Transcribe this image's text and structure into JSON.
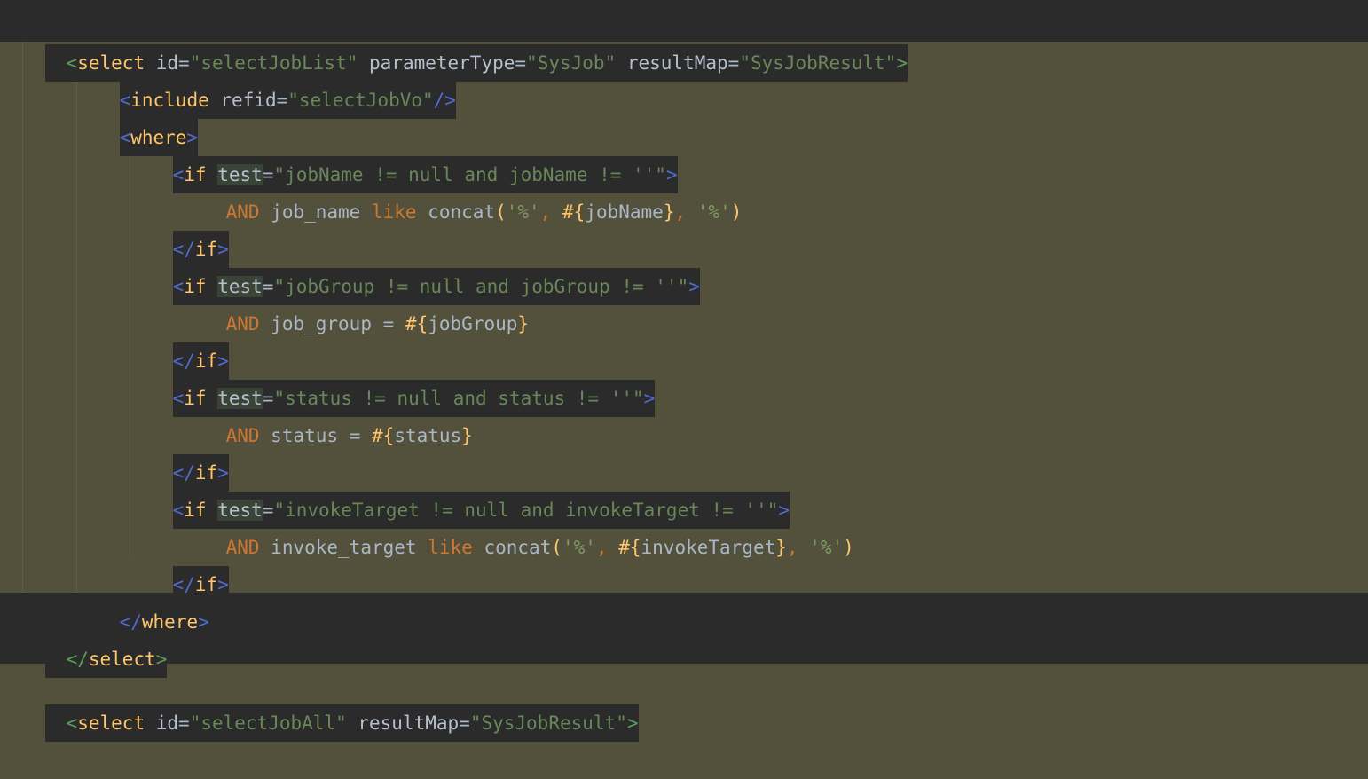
{
  "editor": {
    "language": "xml-mybatis",
    "theme": "darcula-olive-selection",
    "colors": {
      "selection_background": "#53503c",
      "editor_background": "#2b2b2b",
      "search_highlight": "#394437",
      "tag_name": "#ffc66d",
      "bracket_outer": "#5a9e5a",
      "bracket_inner": "#4f6ad0",
      "attribute_name": "#b7c0cc",
      "attribute_value": "#6a8759",
      "sql_keyword": "#cc7832",
      "identifier": "#a9b7c6",
      "punctuation": "#ffc66d",
      "string_literal": "#7f9a64",
      "indent_guide": "#5f5c48"
    },
    "search_term": "test"
  },
  "lines": [
    {
      "index": 0,
      "indent": "",
      "text": "<select id=\"selectJobList\" parameterType=\"SysJob\" resultMap=\"SysJobResult\">",
      "tokens": {
        "open": "<",
        "tag": "select",
        "a1_name": "id",
        "a1_eq": "=",
        "a1_val": "\"selectJobList\"",
        "a2_name": "parameterType",
        "a2_eq": "=",
        "a2_val": "\"SysJob\"",
        "a3_name": "resultMap",
        "a3_eq": "=",
        "a3_val": "\"SysJobResult\"",
        "close": ">"
      }
    },
    {
      "index": 1,
      "indent": "    ",
      "text": "<include refid=\"selectJobVo\"/>",
      "tokens": {
        "open": "<",
        "tag": "include",
        "a1_name": "refid",
        "a1_eq": "=",
        "a1_val": "\"selectJobVo\"",
        "close": "/>"
      }
    },
    {
      "index": 2,
      "indent": "    ",
      "text": "<where>",
      "tokens": {
        "open": "<",
        "tag": "where",
        "close": ">"
      }
    },
    {
      "index": 3,
      "indent": "        ",
      "text": "<if test=\"jobName != null and jobName != ''\">",
      "tokens": {
        "open": "<",
        "tag": "if",
        "a1_name": "test",
        "a1_eq": "=",
        "a1_val": "\"jobName != null and jobName != ''\"",
        "close": ">"
      }
    },
    {
      "index": 4,
      "indent": "            ",
      "text": "AND job_name like concat('%', #{jobName}, '%')",
      "tokens": {
        "kw1": "AND",
        "col": "job_name",
        "kw2": "like",
        "fn": "concat",
        "lparen": "(",
        "s1": "'%'",
        "c1": ",",
        "hash": "#",
        "lbrace": "{",
        "param": "jobName",
        "rbrace": "}",
        "c2": ",",
        "s2": "'%'",
        "rparen": ")"
      }
    },
    {
      "index": 5,
      "indent": "        ",
      "text": "</if>",
      "tokens": {
        "open": "</",
        "tag": "if",
        "close": ">"
      }
    },
    {
      "index": 6,
      "indent": "        ",
      "text": "<if test=\"jobGroup != null and jobGroup != ''\">",
      "tokens": {
        "open": "<",
        "tag": "if",
        "a1_name": "test",
        "a1_eq": "=",
        "a1_val": "\"jobGroup != null and jobGroup != ''\"",
        "close": ">"
      }
    },
    {
      "index": 7,
      "indent": "            ",
      "text": "AND job_group = #{jobGroup}",
      "tokens": {
        "kw1": "AND",
        "col": "job_group",
        "eq": "=",
        "hash": "#",
        "lbrace": "{",
        "param": "jobGroup",
        "rbrace": "}"
      }
    },
    {
      "index": 8,
      "indent": "        ",
      "text": "</if>",
      "tokens": {
        "open": "</",
        "tag": "if",
        "close": ">"
      }
    },
    {
      "index": 9,
      "indent": "        ",
      "text": "<if test=\"status != null and status != ''\">",
      "tokens": {
        "open": "<",
        "tag": "if",
        "a1_name": "test",
        "a1_eq": "=",
        "a1_val": "\"status != null and status != ''\"",
        "close": ">"
      }
    },
    {
      "index": 10,
      "indent": "            ",
      "text": "AND status = #{status}",
      "tokens": {
        "kw1": "AND",
        "col": "status",
        "eq": "=",
        "hash": "#",
        "lbrace": "{",
        "param": "status",
        "rbrace": "}"
      }
    },
    {
      "index": 11,
      "indent": "        ",
      "text": "</if>",
      "tokens": {
        "open": "</",
        "tag": "if",
        "close": ">"
      }
    },
    {
      "index": 12,
      "indent": "        ",
      "text": "<if test=\"invokeTarget != null and invokeTarget != ''\">",
      "tokens": {
        "open": "<",
        "tag": "if",
        "a1_name": "test",
        "a1_eq": "=",
        "a1_val": "\"invokeTarget != null and invokeTarget != ''\"",
        "close": ">"
      }
    },
    {
      "index": 13,
      "indent": "            ",
      "text": "AND invoke_target like concat('%', #{invokeTarget}, '%')",
      "tokens": {
        "kw1": "AND",
        "col": "invoke_target",
        "kw2": "like",
        "fn": "concat",
        "lparen": "(",
        "s1": "'%'",
        "c1": ",",
        "hash": "#",
        "lbrace": "{",
        "param": "invokeTarget",
        "rbrace": "}",
        "c2": ",",
        "s2": "'%'",
        "rparen": ")"
      }
    },
    {
      "index": 14,
      "indent": "        ",
      "text": "</if>",
      "tokens": {
        "open": "</",
        "tag": "if",
        "close": ">"
      }
    },
    {
      "index": 15,
      "indent": "    ",
      "text": "</where>",
      "tokens": {
        "open": "</",
        "tag": "where",
        "close": ">"
      }
    },
    {
      "index": 16,
      "indent": "",
      "text": "</select>",
      "tokens": {
        "open": "</",
        "tag": "select",
        "close": ">"
      }
    },
    {
      "index": 17,
      "indent": "",
      "text": "",
      "tokens": {}
    },
    {
      "index": 18,
      "indent": "",
      "text": "<select id=\"selectJobAll\" resultMap=\"SysJobResult\">",
      "tokens": {
        "open": "<",
        "tag": "select",
        "a1_name": "id",
        "a1_eq": "=",
        "a1_val": "\"selectJobAll\"",
        "a2_name": "resultMap",
        "a2_eq": "=",
        "a2_val": "\"SysJobResult\"",
        "close": ">"
      }
    }
  ]
}
